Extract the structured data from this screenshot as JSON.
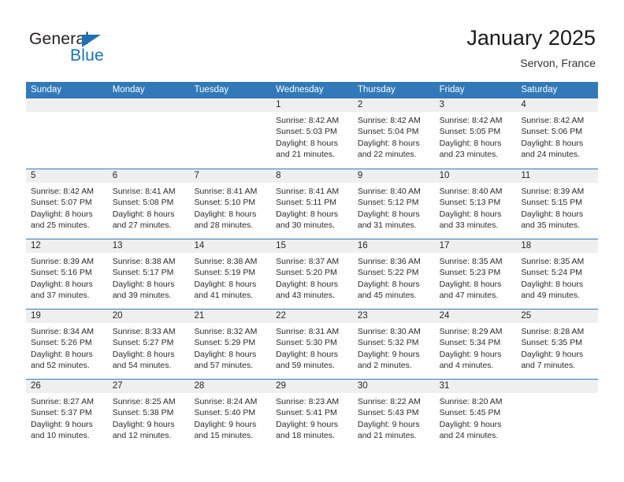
{
  "brand": {
    "name_part1": "General",
    "name_part2": "Blue",
    "color_dark": "#231f20",
    "color_blue": "#1273c4"
  },
  "header": {
    "title": "January 2025",
    "location": "Servon, France"
  },
  "theme": {
    "header_blue": "#3179b9",
    "band_gray": "#efefef"
  },
  "weekdays": [
    "Sunday",
    "Monday",
    "Tuesday",
    "Wednesday",
    "Thursday",
    "Friday",
    "Saturday"
  ],
  "weeks": [
    [
      {
        "day": "",
        "lines": []
      },
      {
        "day": "",
        "lines": []
      },
      {
        "day": "",
        "lines": []
      },
      {
        "day": "1",
        "lines": [
          "Sunrise: 8:42 AM",
          "Sunset: 5:03 PM",
          "Daylight: 8 hours",
          "and 21 minutes."
        ]
      },
      {
        "day": "2",
        "lines": [
          "Sunrise: 8:42 AM",
          "Sunset: 5:04 PM",
          "Daylight: 8 hours",
          "and 22 minutes."
        ]
      },
      {
        "day": "3",
        "lines": [
          "Sunrise: 8:42 AM",
          "Sunset: 5:05 PM",
          "Daylight: 8 hours",
          "and 23 minutes."
        ]
      },
      {
        "day": "4",
        "lines": [
          "Sunrise: 8:42 AM",
          "Sunset: 5:06 PM",
          "Daylight: 8 hours",
          "and 24 minutes."
        ]
      }
    ],
    [
      {
        "day": "5",
        "lines": [
          "Sunrise: 8:42 AM",
          "Sunset: 5:07 PM",
          "Daylight: 8 hours",
          "and 25 minutes."
        ]
      },
      {
        "day": "6",
        "lines": [
          "Sunrise: 8:41 AM",
          "Sunset: 5:08 PM",
          "Daylight: 8 hours",
          "and 27 minutes."
        ]
      },
      {
        "day": "7",
        "lines": [
          "Sunrise: 8:41 AM",
          "Sunset: 5:10 PM",
          "Daylight: 8 hours",
          "and 28 minutes."
        ]
      },
      {
        "day": "8",
        "lines": [
          "Sunrise: 8:41 AM",
          "Sunset: 5:11 PM",
          "Daylight: 8 hours",
          "and 30 minutes."
        ]
      },
      {
        "day": "9",
        "lines": [
          "Sunrise: 8:40 AM",
          "Sunset: 5:12 PM",
          "Daylight: 8 hours",
          "and 31 minutes."
        ]
      },
      {
        "day": "10",
        "lines": [
          "Sunrise: 8:40 AM",
          "Sunset: 5:13 PM",
          "Daylight: 8 hours",
          "and 33 minutes."
        ]
      },
      {
        "day": "11",
        "lines": [
          "Sunrise: 8:39 AM",
          "Sunset: 5:15 PM",
          "Daylight: 8 hours",
          "and 35 minutes."
        ]
      }
    ],
    [
      {
        "day": "12",
        "lines": [
          "Sunrise: 8:39 AM",
          "Sunset: 5:16 PM",
          "Daylight: 8 hours",
          "and 37 minutes."
        ]
      },
      {
        "day": "13",
        "lines": [
          "Sunrise: 8:38 AM",
          "Sunset: 5:17 PM",
          "Daylight: 8 hours",
          "and 39 minutes."
        ]
      },
      {
        "day": "14",
        "lines": [
          "Sunrise: 8:38 AM",
          "Sunset: 5:19 PM",
          "Daylight: 8 hours",
          "and 41 minutes."
        ]
      },
      {
        "day": "15",
        "lines": [
          "Sunrise: 8:37 AM",
          "Sunset: 5:20 PM",
          "Daylight: 8 hours",
          "and 43 minutes."
        ]
      },
      {
        "day": "16",
        "lines": [
          "Sunrise: 8:36 AM",
          "Sunset: 5:22 PM",
          "Daylight: 8 hours",
          "and 45 minutes."
        ]
      },
      {
        "day": "17",
        "lines": [
          "Sunrise: 8:35 AM",
          "Sunset: 5:23 PM",
          "Daylight: 8 hours",
          "and 47 minutes."
        ]
      },
      {
        "day": "18",
        "lines": [
          "Sunrise: 8:35 AM",
          "Sunset: 5:24 PM",
          "Daylight: 8 hours",
          "and 49 minutes."
        ]
      }
    ],
    [
      {
        "day": "19",
        "lines": [
          "Sunrise: 8:34 AM",
          "Sunset: 5:26 PM",
          "Daylight: 8 hours",
          "and 52 minutes."
        ]
      },
      {
        "day": "20",
        "lines": [
          "Sunrise: 8:33 AM",
          "Sunset: 5:27 PM",
          "Daylight: 8 hours",
          "and 54 minutes."
        ]
      },
      {
        "day": "21",
        "lines": [
          "Sunrise: 8:32 AM",
          "Sunset: 5:29 PM",
          "Daylight: 8 hours",
          "and 57 minutes."
        ]
      },
      {
        "day": "22",
        "lines": [
          "Sunrise: 8:31 AM",
          "Sunset: 5:30 PM",
          "Daylight: 8 hours",
          "and 59 minutes."
        ]
      },
      {
        "day": "23",
        "lines": [
          "Sunrise: 8:30 AM",
          "Sunset: 5:32 PM",
          "Daylight: 9 hours",
          "and 2 minutes."
        ]
      },
      {
        "day": "24",
        "lines": [
          "Sunrise: 8:29 AM",
          "Sunset: 5:34 PM",
          "Daylight: 9 hours",
          "and 4 minutes."
        ]
      },
      {
        "day": "25",
        "lines": [
          "Sunrise: 8:28 AM",
          "Sunset: 5:35 PM",
          "Daylight: 9 hours",
          "and 7 minutes."
        ]
      }
    ],
    [
      {
        "day": "26",
        "lines": [
          "Sunrise: 8:27 AM",
          "Sunset: 5:37 PM",
          "Daylight: 9 hours",
          "and 10 minutes."
        ]
      },
      {
        "day": "27",
        "lines": [
          "Sunrise: 8:25 AM",
          "Sunset: 5:38 PM",
          "Daylight: 9 hours",
          "and 12 minutes."
        ]
      },
      {
        "day": "28",
        "lines": [
          "Sunrise: 8:24 AM",
          "Sunset: 5:40 PM",
          "Daylight: 9 hours",
          "and 15 minutes."
        ]
      },
      {
        "day": "29",
        "lines": [
          "Sunrise: 8:23 AM",
          "Sunset: 5:41 PM",
          "Daylight: 9 hours",
          "and 18 minutes."
        ]
      },
      {
        "day": "30",
        "lines": [
          "Sunrise: 8:22 AM",
          "Sunset: 5:43 PM",
          "Daylight: 9 hours",
          "and 21 minutes."
        ]
      },
      {
        "day": "31",
        "lines": [
          "Sunrise: 8:20 AM",
          "Sunset: 5:45 PM",
          "Daylight: 9 hours",
          "and 24 minutes."
        ]
      },
      {
        "day": "",
        "lines": []
      }
    ]
  ]
}
